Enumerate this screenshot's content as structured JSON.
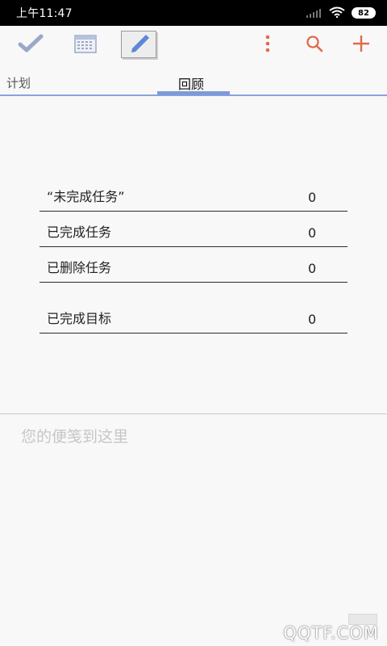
{
  "status_bar": {
    "time": "上午11:47",
    "battery": "82"
  },
  "toolbar": {
    "icons": [
      "check-icon",
      "calendar-icon",
      "pencil-icon",
      "more-vert-icon",
      "search-icon",
      "plus-icon"
    ],
    "accent_color": "#e06a4a",
    "muted_color": "#9aa8c8"
  },
  "tabs": {
    "plan": "计划",
    "review": "回顾",
    "indicator_color": "#7e9ad8"
  },
  "stats": [
    {
      "label": "“未完成任务”",
      "value": "0"
    },
    {
      "label": "已完成任务",
      "value": "0"
    },
    {
      "label": "已删除任务",
      "value": "0"
    },
    {
      "label": "已完成目标",
      "value": "0"
    }
  ],
  "notes": {
    "placeholder": "您的便笺到这里"
  },
  "watermark": {
    "text": "QQTF.COM"
  }
}
